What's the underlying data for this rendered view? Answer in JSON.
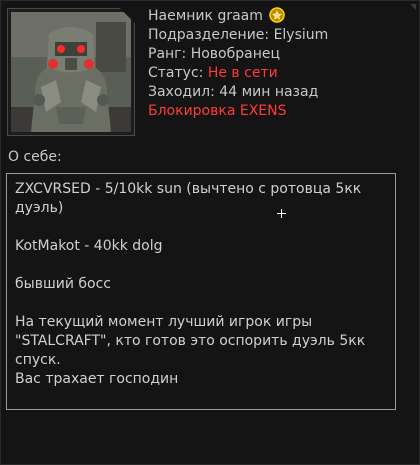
{
  "profile": {
    "name": "Наемник graam",
    "division": "Подразделение: Elysium",
    "rank": "Ранг: Новобранец",
    "status_label": "Статус: ",
    "status_value": "Не в сети",
    "last_seen": "Заходил: 44 мин назад",
    "block": "Блокировка EXENS"
  },
  "about": {
    "label": "О себе:",
    "text": "ZXCVRSED - 5/10kk sun (вычтено с ротовца 5кк\nдуэль)\n\nKotMakot - 40kk dolg\n\nбывший босс\n\nНа текущий момент лучший игрок игры\n\"STALCRAFT\", кто готов это оспорить дуэль 5кк\nспуск.\nВас трахает господин"
  },
  "colors": {
    "status_offline": "#ff3b3b",
    "text": "#c8c8c8",
    "background": "#141414"
  }
}
